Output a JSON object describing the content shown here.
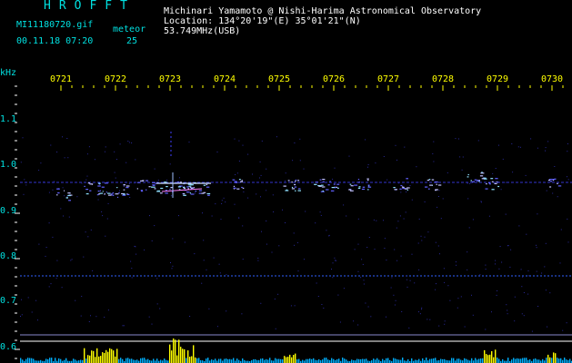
{
  "header": {
    "brand": "HROFFT",
    "filename": "MI11180720.gif",
    "datetime": "00.11.18 07:20",
    "counter_label": "meteor",
    "counter_value": "25",
    "observer": "Michinari Yamamoto @ Nishi-Harima Astronomical Observatory",
    "location": "Location: 134°20'19\"(E) 35°01'21\"(N)",
    "frequency": "53.749MHz(USB)"
  },
  "axis": {
    "unit": "kHz",
    "y_ticks": [
      "1.1",
      "1.0",
      "0.9",
      "0.8",
      "0.7",
      "0.6"
    ],
    "x_ticks": [
      "0721",
      "0722",
      "0723",
      "0724",
      "0725",
      "0726",
      "0727",
      "0728",
      "0729",
      "0730"
    ]
  },
  "colors": {
    "axis_text": "#00e0e0",
    "time_labels": "#ffff00",
    "grid_marks": "#ffffff",
    "signal_trace": "#4040ff",
    "activity_bars": "#ffff00"
  }
}
